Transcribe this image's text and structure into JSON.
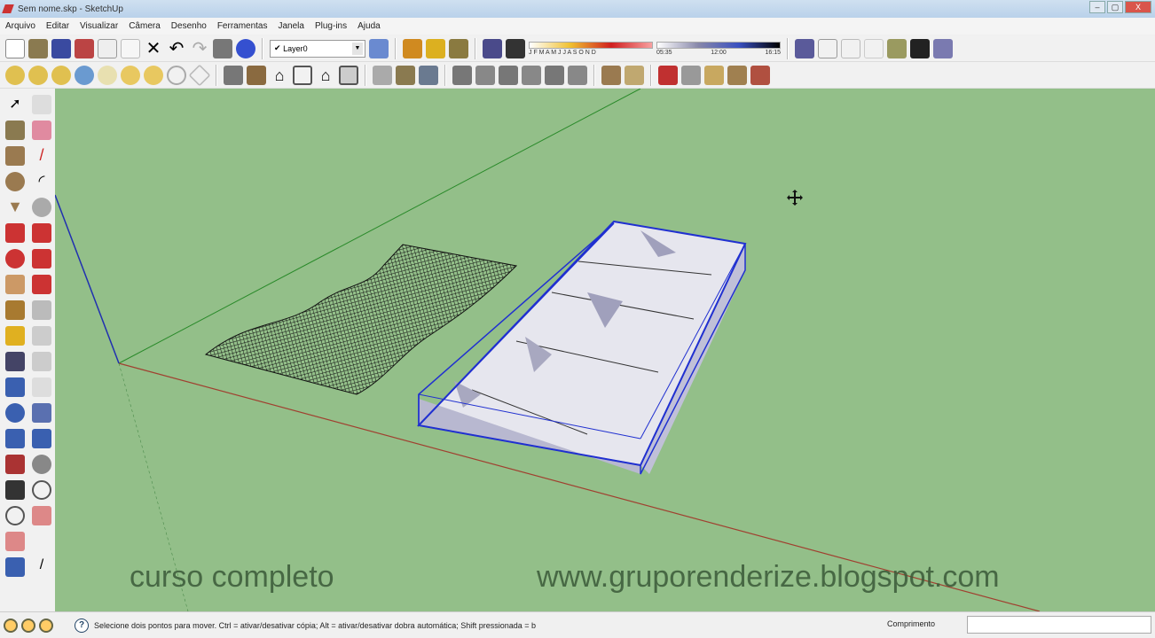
{
  "window": {
    "title": "Sem nome.skp - SketchUp",
    "min": "–",
    "max": "▢",
    "close": "X"
  },
  "menu": [
    "Arquivo",
    "Editar",
    "Visualizar",
    "Câmera",
    "Desenho",
    "Ferramentas",
    "Janela",
    "Plug-ins",
    "Ajuda"
  ],
  "layer": {
    "value": "Layer0",
    "check": "✔",
    "dropdown": "▼"
  },
  "shadow": {
    "months": "J F M A M J J A S O N D",
    "time_start": "05:35",
    "time_mid": "12:00",
    "time_end": "16:15"
  },
  "status": {
    "message": "Selecione dois pontos para mover. Ctrl = ativar/desativar cópia; Alt = ativar/desativar dobra automática; Shift pressionada = b",
    "help": "?",
    "vcb_label": "Comprimento",
    "vcb_value": ""
  },
  "watermark": {
    "left": "curso completo",
    "right": "www.gruporenderize.blogspot.com"
  }
}
